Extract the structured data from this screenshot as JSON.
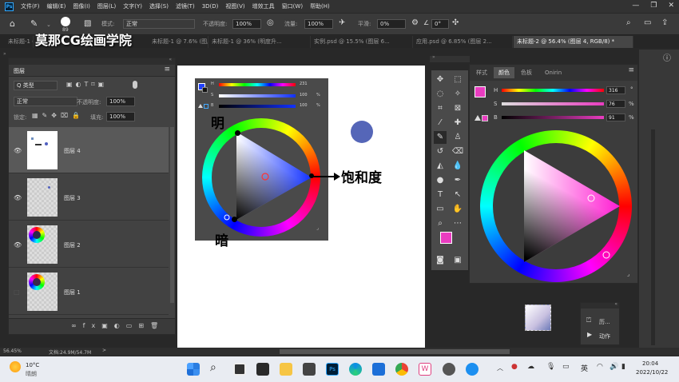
{
  "menubar": {
    "items": [
      "文件(F)",
      "编辑(E)",
      "图像(I)",
      "图层(L)",
      "文字(Y)",
      "选择(S)",
      "滤镜(T)",
      "3D(D)",
      "视图(V)",
      "增效工具",
      "窗口(W)",
      "帮助(H)"
    ]
  },
  "options": {
    "brush_size": "89",
    "mode_label": "模式:",
    "mode_value": "正常",
    "opacity_label": "不透明度:",
    "opacity_value": "100%",
    "flow_label": "流量:",
    "flow_value": "100%",
    "smooth_label": "平滑:",
    "smooth_value": "0%",
    "angle_value": "0°"
  },
  "tabs": [
    "未标题-1 @ 3...",
    "未标题-1 @ 7.6% (图层 4, RGB/8)",
    "未标题-1 @ 36% (明度升...",
    "实例.psd @ 15.5% (图层 6...",
    "应用.psd @ 6.85% (图层 2...",
    "未标题-2 @ 56.4% (图层 4, RGB/8) *"
  ],
  "watermark": "莫那CG绘画学院",
  "layers_panel": {
    "title": "图层",
    "kind_label": "Q 类型",
    "blend_mode": "正常",
    "opacity_label": "不透明度:",
    "opacity_value": "100%",
    "lock_label": "锁定:",
    "fill_label": "填充:",
    "fill_value": "100%",
    "layers": [
      {
        "name": "图层 4",
        "selected": true
      },
      {
        "name": "图层 3",
        "selected": false
      },
      {
        "name": "图层 2",
        "selected": false
      },
      {
        "name": "图层 1",
        "selected": false
      }
    ]
  },
  "canvas_annotations": {
    "bright": "明",
    "dark": "暗",
    "saturation": "饱和度"
  },
  "mini_picker": {
    "h_label": "H",
    "h_value": "231",
    "s_label": "S",
    "s_value": "100",
    "b_label": "B",
    "b_value": "100",
    "pct": "%"
  },
  "color_panel": {
    "tabs": [
      "样式",
      "颜色",
      "色板",
      "Onirin"
    ],
    "active_tab": "颜色",
    "h_label": "H",
    "h_value": "316",
    "deg": "°",
    "s_label": "S",
    "s_value": "76",
    "b_label": "B",
    "b_value": "91",
    "pct": "%",
    "foreground": "#e93cc0",
    "background": "#2a1a14"
  },
  "history_panel": {
    "history_label": "历...",
    "actions_label": "动作"
  },
  "status": {
    "zoom": "56.45%",
    "doc": "文档:24.9M/54.7M"
  },
  "taskbar": {
    "temp": "10°C",
    "weather": "晴朗",
    "ime": "英",
    "time": "20:04",
    "date": "2022/10/22"
  }
}
